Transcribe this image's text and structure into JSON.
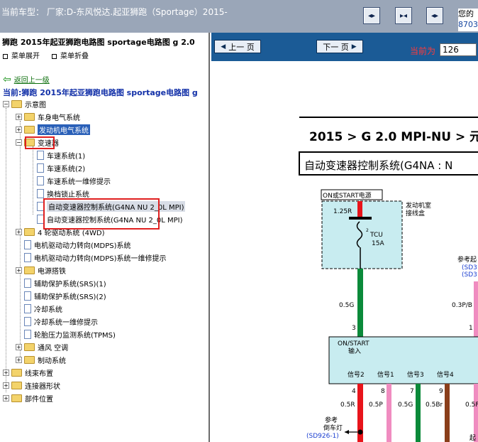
{
  "topbar": {
    "title": "当前车型：  厂家:D-东风悦达.起亚狮跑（Sportage）2015-",
    "buttons": [
      {
        "name": "first-page-button",
        "glyph": "◂▸"
      },
      {
        "name": "split-view-button",
        "glyph": "▸◂"
      },
      {
        "name": "last-page-button",
        "glyph": "◂▸"
      }
    ],
    "info_line1": "您的",
    "info_line2": "8703"
  },
  "sidebar": {
    "title": "狮跑 2015年起亚狮跑电路图 sportage电路图 g 2.0",
    "expand_all": "菜单展开",
    "collapse_all": "菜单折叠",
    "back_link": "返回上一级",
    "current": "当前:狮跑 2015年起亚狮跑电路图 sportage电路图 g",
    "tree": [
      {
        "label": "示意图",
        "type": "folder-open",
        "level": 0,
        "toggle": "−"
      },
      {
        "label": "车身电气系统",
        "type": "folder",
        "level": 1,
        "toggle": "+"
      },
      {
        "label": "发动机电气系统",
        "type": "folder",
        "level": 1,
        "toggle": "+",
        "state": "selected"
      },
      {
        "label": "变速器",
        "type": "folder-open",
        "level": 1,
        "toggle": "−"
      },
      {
        "label": "车速系统(1)",
        "type": "doc",
        "level": 2
      },
      {
        "label": "车速系统(2)",
        "type": "doc",
        "level": 2
      },
      {
        "label": "车速系统一维修提示",
        "type": "doc",
        "level": 2
      },
      {
        "label": "换档锁止系统",
        "type": "doc",
        "level": 2
      },
      {
        "label": "自动变速器控制系统(G4NA NU 2_0L MPI)",
        "type": "doc",
        "level": 2,
        "state": "highlighted"
      },
      {
        "label": "自动变速器控制系统(G4NA NU 2_0L MPI)",
        "type": "doc",
        "level": 2
      },
      {
        "label": "4 轮驱动系统 (4WD)",
        "type": "folder",
        "level": 1,
        "toggle": "+"
      },
      {
        "label": "电机驱动动力转向(MDPS)系统",
        "type": "doc",
        "level": 1
      },
      {
        "label": "电机驱动动力转向(MDPS)系统一维修提示",
        "type": "doc",
        "level": 1
      },
      {
        "label": "电源搭铁",
        "type": "folder",
        "level": 1,
        "toggle": "+"
      },
      {
        "label": "辅助保护系统(SRS)(1)",
        "type": "doc",
        "level": 1
      },
      {
        "label": "辅助保护系统(SRS)(2)",
        "type": "doc",
        "level": 1
      },
      {
        "label": "冷却系统",
        "type": "doc",
        "level": 1
      },
      {
        "label": "冷却系统一维修提示",
        "type": "doc",
        "level": 1
      },
      {
        "label": "轮胎压力监测系统(TPMS)",
        "type": "doc",
        "level": 1
      },
      {
        "label": "通风 空调",
        "type": "folder",
        "level": 1,
        "toggle": "+"
      },
      {
        "label": "制动系统",
        "type": "folder",
        "level": 1,
        "toggle": "+"
      },
      {
        "label": "线束布置",
        "type": "folder",
        "level": 0,
        "toggle": "+"
      },
      {
        "label": "连接器形状",
        "type": "folder",
        "level": 0,
        "toggle": "+"
      },
      {
        "label": "部件位置",
        "type": "folder",
        "level": 0,
        "toggle": "+"
      }
    ]
  },
  "toolbar": {
    "prev_label": "上一 页",
    "next_label": "下一 页",
    "page_label": "当前为",
    "page_value": "126"
  },
  "diagram": {
    "breadcrumb": "2015 > G 2.0 MPI-NU > 元",
    "system_title": "自动变速器控制系统(G4NA : N",
    "power_label": "ON或START电源",
    "junction_box": "发动机室\n接线盒",
    "wire_125r": "1.25R",
    "fuse_num": "2",
    "fuse_name": "TCU",
    "fuse_amp": "15A",
    "ref_label": "参考起",
    "ref_code1": "(SD3",
    "ref_code2": "(SD3",
    "wire_05g": "0.5G",
    "wire_03pb": "0.3P/B",
    "pin3": "3",
    "pin1": "1",
    "ecu_line1": "ON/START",
    "ecu_line2": "输入",
    "signals": [
      "信号2",
      "信号1",
      "信号3",
      "信号4"
    ],
    "pins_bottom": [
      "4",
      "8",
      "7",
      "9"
    ],
    "wires_bottom": [
      "0.5R",
      "0.5P",
      "0.5G",
      "0.5Br",
      "0.5F"
    ],
    "reverse_ref": "参考",
    "reverse_label": "倒车灯",
    "reverse_code": "(SD926-1)",
    "bottom_right": "起",
    "colors": {
      "red": "#e8141b",
      "green": "#0a8a3a",
      "pink": "#f08cc0",
      "brown": "#8a3e1a",
      "blue_box": "#c8ecf0",
      "ref_blue": "#1a3ed0"
    }
  }
}
